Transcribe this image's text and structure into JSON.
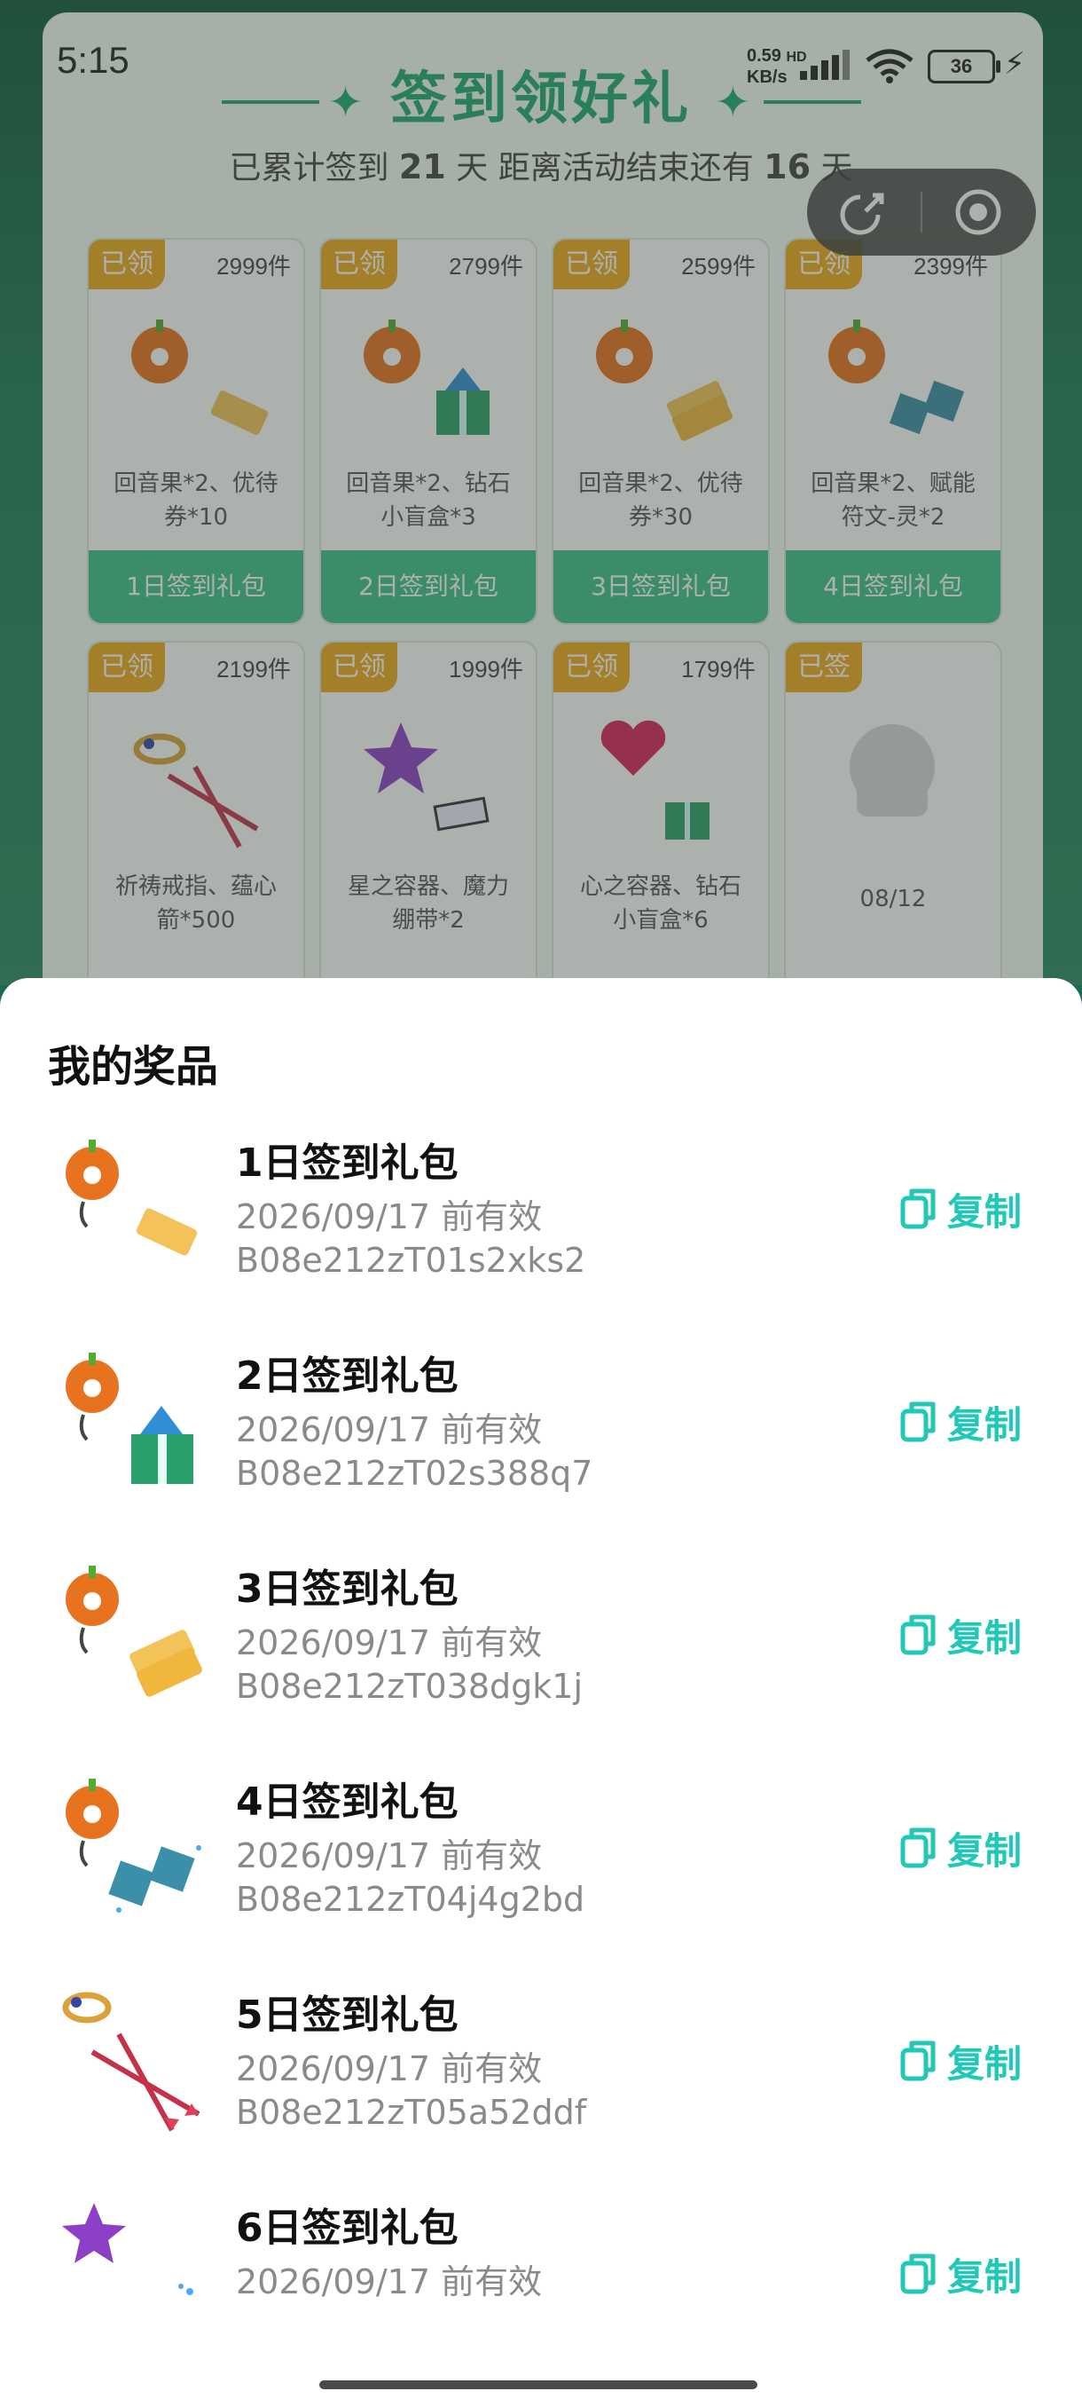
{
  "status_bar": {
    "time": "5:15",
    "net_speed_value": "0.59",
    "net_speed_unit": "KB/s",
    "net_type": "HD",
    "battery": "36",
    "signal_icon": "signal-bars-icon",
    "wifi_icon": "wifi-icon",
    "charging_icon": "charging-bolt-icon"
  },
  "capsule": {
    "share_icon": "share-icon",
    "close_icon": "close-mini-program-icon"
  },
  "background": {
    "title": "签到领好礼",
    "subtitle_prefix": "已累计签到",
    "signed_days": "21",
    "subtitle_mid": "天  距离活动结束还有",
    "remaining_days": "16",
    "subtitle_suffix": "天",
    "cards": [
      {
        "tag": "已领",
        "count": "2999件",
        "name_line1": "回音果*2、优待",
        "name_line2": "券*10",
        "button": "1日签到礼包"
      },
      {
        "tag": "已领",
        "count": "2799件",
        "name_line1": "回音果*2、钻石",
        "name_line2": "小盲盒*3",
        "button": "2日签到礼包"
      },
      {
        "tag": "已领",
        "count": "2599件",
        "name_line1": "回音果*2、优待",
        "name_line2": "券*30",
        "button": "3日签到礼包"
      },
      {
        "tag": "已领",
        "count": "2399件",
        "name_line1": "回音果*2、赋能",
        "name_line2": "符文-灵*2",
        "button": "4日签到礼包"
      },
      {
        "tag": "已领",
        "count": "2199件",
        "name_line1": "祈祷戒指、蕴心",
        "name_line2": "箭*500",
        "button": ""
      },
      {
        "tag": "已领",
        "count": "1999件",
        "name_line1": "星之容器、魔力",
        "name_line2": "绷带*2",
        "button": ""
      },
      {
        "tag": "已领",
        "count": "1799件",
        "name_line1": "心之容器、钻石",
        "name_line2": "小盲盒*6",
        "button": ""
      },
      {
        "tag": "已签",
        "count": "",
        "name_line1": "08/12",
        "name_line2": "",
        "button": ""
      }
    ]
  },
  "sheet": {
    "title": "我的奖品",
    "copy_label": "复制",
    "copy_icon": "copy-icon",
    "items": [
      {
        "name": "1日签到礼包",
        "valid": "2026/09/17 前有效",
        "code": "B08e212zT01s2xks2"
      },
      {
        "name": "2日签到礼包",
        "valid": "2026/09/17 前有效",
        "code": "B08e212zT02s388q7"
      },
      {
        "name": "3日签到礼包",
        "valid": "2026/09/17 前有效",
        "code": "B08e212zT038dgk1j"
      },
      {
        "name": "4日签到礼包",
        "valid": "2026/09/17 前有效",
        "code": "B08e212zT04j4g2bd"
      },
      {
        "name": "5日签到礼包",
        "valid": "2026/09/17 前有效",
        "code": "B08e212zT05a52ddf"
      },
      {
        "name": "6日签到礼包",
        "valid": "2026/09/17 前有效",
        "code": ""
      }
    ]
  },
  "colors": {
    "accent": "#1fc9b6",
    "tag": "#f0a91e",
    "green_button": "#3cbf8a",
    "title_green": "#1ea870"
  }
}
